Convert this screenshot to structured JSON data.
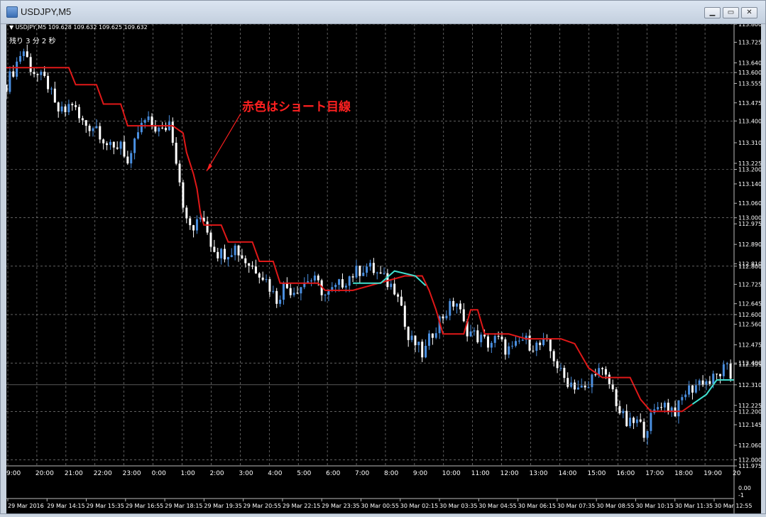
{
  "window": {
    "title": "USDJPY,M5",
    "minimize_label": "▁",
    "restore_label": "▭",
    "close_label": "✕"
  },
  "chart": {
    "info_line": "▼ USDJPY,M5  109.628 109.632 109.625 109.632",
    "timer_text": "残り 3 分 2 秒",
    "annotation_text": "赤色はショート目線",
    "colors": {
      "background": "#000000",
      "grid": "#9a9a9a",
      "bull_candle": "#4a8fe0",
      "bear_candle": "#ffffff",
      "red_line": "#e01818",
      "cyan_line": "#40e0d0",
      "annotation": "#ff2020"
    },
    "price_tick_labels": [
      "113.800",
      "113.725",
      "113.640",
      "113.600",
      "113.555",
      "113.475",
      "113.400",
      "113.310",
      "113.225",
      "113.200",
      "113.140",
      "113.060",
      "113.000",
      "112.975",
      "112.890",
      "112.810",
      "112.800",
      "112.725",
      "112.645",
      "112.600",
      "112.560",
      "112.475",
      "112.400",
      "112.395",
      "112.310",
      "112.225",
      "112.200",
      "112.145",
      "112.060",
      "112.000",
      "111.975"
    ],
    "hour_labels": [
      "9:00",
      "20:00",
      "21:00",
      "22:00",
      "23:00",
      "0:00",
      "1:00",
      "2:00",
      "3:00",
      "4:00",
      "5:00",
      "6:00",
      "7:00",
      "8:00",
      "9:00",
      "10:00",
      "11:00",
      "12:00",
      "13:00",
      "14:00",
      "15:00",
      "16:00",
      "17:00",
      "18:00",
      "19:00",
      "20"
    ],
    "date_labels": [
      "29 Mar 2016",
      "29 Mar 14:15",
      "29 Mar 15:35",
      "29 Mar 16:55",
      "29 Mar 18:15",
      "29 Mar 19:35",
      "29 Mar 20:55",
      "29 Mar 22:15",
      "29 Mar 23:35",
      "30 Mar 00:55",
      "30 Mar 02:15",
      "30 Mar 03:35",
      "30 Mar 04:55",
      "30 Mar 06:15",
      "30 Mar 07:35",
      "30 Mar 08:55",
      "30 Mar 10:15",
      "30 Mar 11:35",
      "30 Mar 12:55"
    ],
    "subwindow_labels": [
      "0.00",
      "-1"
    ]
  },
  "chart_data": {
    "type": "line",
    "title": "USDJPY,M5",
    "ylim": [
      111.975,
      113.8
    ],
    "y_gridlines": [
      113.8,
      113.6,
      113.4,
      113.2,
      113.0,
      112.8,
      112.6,
      112.4,
      112.2,
      112.0
    ],
    "x_gridlines_per_hour": true,
    "current_price": 112.31,
    "price_path": [
      [
        0,
        113.55
      ],
      [
        1,
        113.62
      ],
      [
        2,
        113.7
      ],
      [
        3,
        113.62
      ],
      [
        4,
        113.58
      ],
      [
        5,
        113.56
      ],
      [
        6,
        113.45
      ],
      [
        7,
        113.43
      ],
      [
        8,
        113.48
      ],
      [
        9,
        113.4
      ],
      [
        10,
        113.38
      ],
      [
        11,
        113.38
      ],
      [
        12,
        113.32
      ],
      [
        13,
        113.27
      ],
      [
        14,
        113.32
      ],
      [
        15,
        113.2
      ],
      [
        16,
        113.35
      ],
      [
        17,
        113.4
      ],
      [
        18,
        113.38
      ],
      [
        19,
        113.35
      ],
      [
        20,
        113.4
      ],
      [
        21,
        113.2
      ],
      [
        22,
        112.98
      ],
      [
        23,
        112.95
      ],
      [
        24,
        113.02
      ],
      [
        25,
        112.9
      ],
      [
        26,
        112.85
      ],
      [
        27,
        112.86
      ],
      [
        28,
        112.88
      ],
      [
        29,
        112.83
      ],
      [
        30,
        112.8
      ],
      [
        31,
        112.78
      ],
      [
        32,
        112.73
      ],
      [
        33,
        112.66
      ],
      [
        34,
        112.72
      ],
      [
        35,
        112.7
      ],
      [
        36,
        112.72
      ],
      [
        37,
        112.75
      ],
      [
        38,
        112.73
      ],
      [
        39,
        112.68
      ],
      [
        40,
        112.7
      ],
      [
        41,
        112.73
      ],
      [
        42,
        112.76
      ],
      [
        43,
        112.78
      ],
      [
        44,
        112.8
      ],
      [
        45,
        112.78
      ],
      [
        46,
        112.75
      ],
      [
        47,
        112.72
      ],
      [
        48,
        112.7
      ],
      [
        49,
        112.5
      ],
      [
        50,
        112.48
      ],
      [
        51,
        112.43
      ],
      [
        52,
        112.52
      ],
      [
        53,
        112.58
      ],
      [
        54,
        112.62
      ],
      [
        55,
        112.66
      ],
      [
        56,
        112.55
      ],
      [
        57,
        112.52
      ],
      [
        58,
        112.5
      ],
      [
        59,
        112.48
      ],
      [
        60,
        112.5
      ],
      [
        61,
        112.46
      ],
      [
        62,
        112.45
      ],
      [
        63,
        112.5
      ],
      [
        64,
        112.48
      ],
      [
        65,
        112.47
      ],
      [
        66,
        112.48
      ],
      [
        67,
        112.42
      ],
      [
        68,
        112.34
      ],
      [
        69,
        112.32
      ],
      [
        70,
        112.3
      ],
      [
        71,
        112.28
      ],
      [
        72,
        112.38
      ],
      [
        73,
        112.35
      ],
      [
        74,
        112.3
      ],
      [
        75,
        112.2
      ],
      [
        76,
        112.14
      ],
      [
        77,
        112.16
      ],
      [
        78,
        112.12
      ],
      [
        79,
        112.18
      ],
      [
        80,
        112.24
      ],
      [
        81,
        112.22
      ],
      [
        82,
        112.2
      ],
      [
        83,
        112.28
      ],
      [
        84,
        112.3
      ],
      [
        85,
        112.33
      ],
      [
        86,
        112.32
      ],
      [
        87,
        112.35
      ],
      [
        88,
        112.38
      ],
      [
        89,
        112.31
      ]
    ],
    "red_line": [
      [
        0,
        113.62
      ],
      [
        18,
        113.62
      ],
      [
        20,
        113.55
      ],
      [
        26,
        113.55
      ],
      [
        28,
        113.47
      ],
      [
        33,
        113.47
      ],
      [
        35,
        113.38
      ],
      [
        44,
        113.38
      ],
      [
        48,
        113.38
      ],
      [
        51,
        113.35
      ],
      [
        52,
        113.27
      ],
      [
        54,
        113.18
      ],
      [
        55,
        113.12
      ],
      [
        56,
        113.02
      ],
      [
        57,
        112.97
      ],
      [
        62,
        112.97
      ],
      [
        64,
        112.9
      ],
      [
        71,
        112.9
      ],
      [
        73,
        112.82
      ],
      [
        77,
        112.82
      ],
      [
        79,
        112.73
      ],
      [
        90,
        112.73
      ],
      [
        92,
        112.7
      ],
      [
        100,
        112.7
      ],
      [
        105,
        112.72
      ],
      [
        115,
        112.76
      ],
      [
        120,
        112.76
      ],
      [
        122,
        112.7
      ],
      [
        124,
        112.62
      ],
      [
        126,
        112.52
      ],
      [
        132,
        112.52
      ],
      [
        134,
        112.62
      ],
      [
        136,
        112.62
      ],
      [
        138,
        112.52
      ],
      [
        145,
        112.52
      ],
      [
        150,
        112.5
      ],
      [
        160,
        112.5
      ],
      [
        164,
        112.48
      ],
      [
        168,
        112.38
      ],
      [
        172,
        112.34
      ],
      [
        180,
        112.34
      ],
      [
        183,
        112.25
      ],
      [
        186,
        112.2
      ],
      [
        195,
        112.2
      ],
      [
        198,
        112.23
      ]
    ],
    "cyan_line": [
      [
        100,
        112.73
      ],
      [
        108,
        112.73
      ],
      [
        112,
        112.78
      ],
      [
        118,
        112.76
      ],
      [
        121,
        112.72
      ],
      [
        198,
        112.23
      ],
      [
        202,
        112.27
      ],
      [
        205,
        112.33
      ],
      [
        210,
        112.33
      ]
    ]
  }
}
